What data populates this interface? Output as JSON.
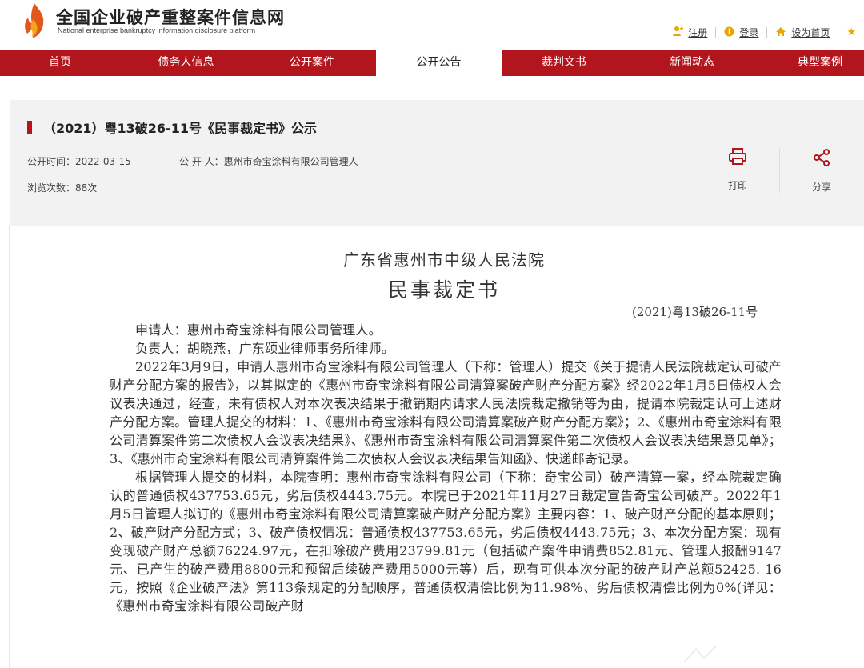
{
  "site": {
    "title": "全国企业破产重整案件信息网",
    "subtitle": "National enterprise bankruptcy  information disclosure platform",
    "brand_color": "#b3151d"
  },
  "top_links": {
    "register": "注册",
    "login": "登录",
    "set_homepage": "设为首页"
  },
  "nav": [
    {
      "label": "首页"
    },
    {
      "label": "债务人信息"
    },
    {
      "label": "公开案件"
    },
    {
      "label": "公开公告",
      "active": true
    },
    {
      "label": "裁判文书"
    },
    {
      "label": "新闻动态"
    },
    {
      "label": "典型案例"
    }
  ],
  "notice": {
    "title": "（2021）粤13破26-11号《民事裁定书》公示",
    "publish_time_label": "公开时间：",
    "publish_time": "2022-03-15",
    "publisher_label": "公 开 人：",
    "publisher": "惠州市奇宝涂料有限公司管理人",
    "views_label": "浏览次数：",
    "views": "88次",
    "print_label": "打印",
    "share_label": "分享"
  },
  "document": {
    "court": "广东省惠州市中级人民法院",
    "doc_type": "民事裁定书",
    "case_number": "(2021)粤13破26-11号",
    "applicant": "申请人：惠州市奇宝涂料有限公司管理人。",
    "principal": "负责人：胡晓燕，广东颂业律师事务所律师。",
    "para1": "2022年3月9日，申请人惠州市奇宝涂料有限公司管理人（下称：管理人）提交《关于提请人民法院裁定认可破产财产分配方案的报告》，以其拟定的《惠州市奇宝涂料有限公司清算案破产财产分配方案》经2022年1月5日债权人会议表决通过，经查，未有债权人对本次表决结果于撤销期内请求人民法院裁定撤销等为由，提请本院裁定认可上述财产分配方案。管理人提交的材料：1、《惠州市奇宝涂料有限公司清算案破产财产分配方案》；2、《惠州市奇宝涂料有限公司清算案件第二次债权人会议表决结果》、《惠州市奇宝涂料有限公司清算案件第二次债权人会议表决结果意见单》；3、《惠州市奇宝涂料有限公司清算案件第二次债权人会议表决结果告知函》、快递邮寄记录。",
    "para2": "根据管理人提交的材料，本院查明：惠州市奇宝涂料有限公司（下称：奇宝公司）破产清算一案，经本院裁定确认的普通债权437753.65元，劣后债权4443.75元。本院已于2021年11月27日裁定宣告奇宝公司破产。2022年1月5日管理人拟订的《惠州市奇宝涂料有限公司清算案破产财产分配方案》主要内容：1、破产财产分配的基本原则；2、破产财产分配方式；3、破产债权情况：普通债权437753.65元，劣后债权4443.75元；3、本次分配方案：现有变现破产财产总额76224.97元，在扣除破产费用23799.81元（包括破产案件申请费852.81元、管理人报酬9147元、已产生的破产费用8800元和预留后续破产费用5000元等）后，现有可供本次分配的破产财产总额52425. 16元，按照《企业破产法》第113条规定的分配顺序，普通债权清偿比例为11.98%、劣后债权清偿比例为0%(详见：《惠州市奇宝涂料有限公司破产财"
  }
}
